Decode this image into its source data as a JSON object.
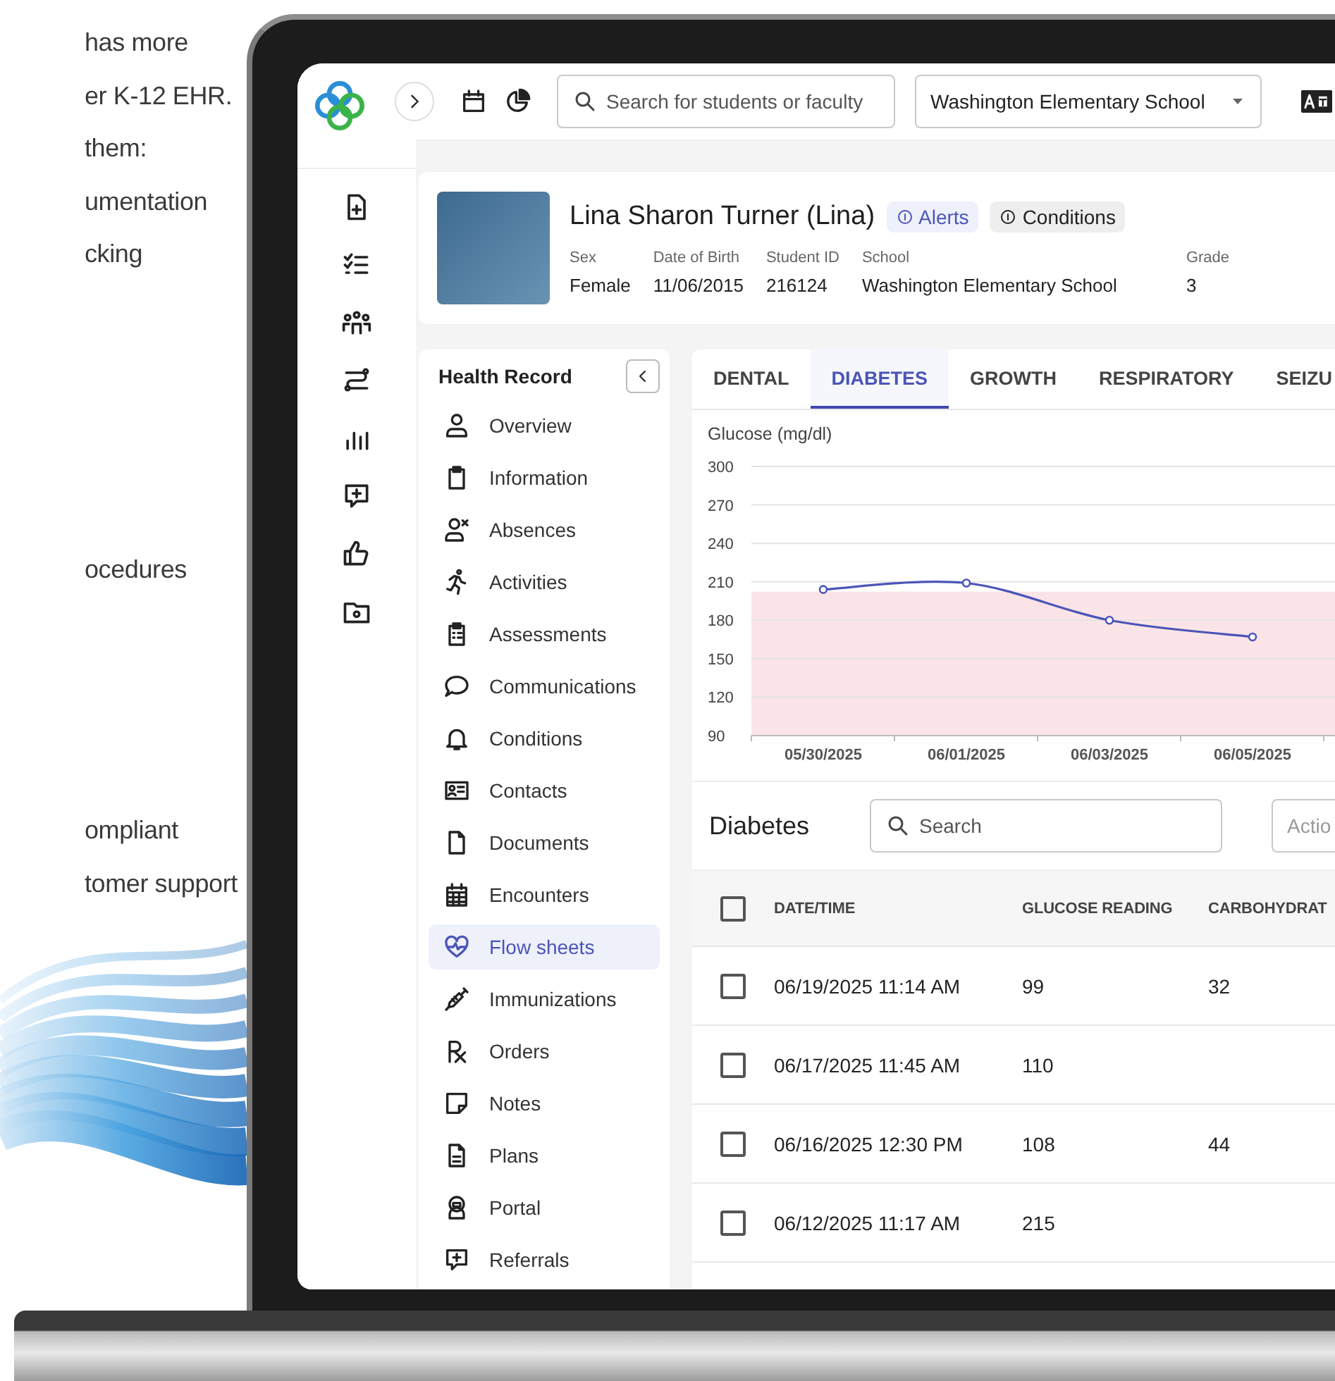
{
  "copy": [
    [
      "has more",
      "er K-12 EHR.",
      "them:",
      "umentation",
      "cking"
    ],
    [
      "ocedures"
    ],
    [
      "ompliant",
      "tomer support"
    ]
  ],
  "topbar": {
    "search": {
      "placeholder": "Search for students or faculty"
    },
    "school_select": {
      "value": "Washington Elementary School"
    }
  },
  "patient": {
    "name": "Lina Sharon Turner (Lina)",
    "badges": [
      {
        "label": "Alerts",
        "kind": "alert"
      },
      {
        "label": "Conditions",
        "kind": "condition"
      }
    ],
    "fields": [
      {
        "label": "Sex",
        "value": "Female"
      },
      {
        "label": "Date of Birth",
        "value": "11/06/2015"
      },
      {
        "label": "Student ID",
        "value": "216124"
      },
      {
        "label": "School",
        "value": "Washington Elementary School"
      },
      {
        "label": "Grade",
        "value": "3"
      }
    ]
  },
  "health_record": {
    "title": "Health Record",
    "items": [
      {
        "label": "Overview",
        "selected": false
      },
      {
        "label": "Information",
        "selected": false
      },
      {
        "label": "Absences",
        "selected": false
      },
      {
        "label": "Activities",
        "selected": false
      },
      {
        "label": "Assessments",
        "selected": false
      },
      {
        "label": "Communications",
        "selected": false
      },
      {
        "label": "Conditions",
        "selected": false
      },
      {
        "label": "Contacts",
        "selected": false
      },
      {
        "label": "Documents",
        "selected": false
      },
      {
        "label": "Encounters",
        "selected": false
      },
      {
        "label": "Flow sheets",
        "selected": true
      },
      {
        "label": "Immunizations",
        "selected": false
      },
      {
        "label": "Orders",
        "selected": false
      },
      {
        "label": "Notes",
        "selected": false
      },
      {
        "label": "Plans",
        "selected": false
      },
      {
        "label": "Portal",
        "selected": false
      },
      {
        "label": "Referrals",
        "selected": false
      }
    ]
  },
  "tabs": [
    {
      "label": "DENTAL",
      "selected": false
    },
    {
      "label": "DIABETES",
      "selected": true
    },
    {
      "label": "GROWTH",
      "selected": false
    },
    {
      "label": "RESPIRATORY",
      "selected": false
    },
    {
      "label": "SEIZU",
      "selected": false
    }
  ],
  "chart_data": {
    "type": "line",
    "ylabel": "Glucose (mg/dl)",
    "categories": [
      "05/30/2025",
      "06/01/2025",
      "06/03/2025",
      "06/05/2025"
    ],
    "series": [
      {
        "color": "#4b55b8",
        "marker": "circle",
        "values": [
          204,
          209,
          180,
          167
        ]
      }
    ],
    "ylim": [
      90,
      300
    ],
    "yticks": [
      90,
      120,
      150,
      180,
      210,
      240,
      270,
      300
    ],
    "grid": true
  },
  "table": {
    "title": "Diabetes",
    "search": {
      "placeholder": "Search"
    },
    "action_field": {
      "placeholder": "Actio"
    },
    "header_checkbox": {
      "checked": false
    },
    "columns": [
      "DATE/TIME",
      "GLUCOSE READING",
      "CARBOHYDRAT"
    ],
    "rows": [
      {
        "checked": false,
        "cells": [
          "06/19/2025 11:14 AM",
          "99",
          "32"
        ]
      },
      {
        "checked": false,
        "cells": [
          "06/17/2025 11:45 AM",
          "110",
          null
        ]
      },
      {
        "checked": false,
        "cells": [
          "06/16/2025 12:30 PM",
          "108",
          "44"
        ]
      },
      {
        "checked": false,
        "cells": [
          "06/12/2025 11:17 AM",
          "215",
          null
        ]
      }
    ]
  }
}
